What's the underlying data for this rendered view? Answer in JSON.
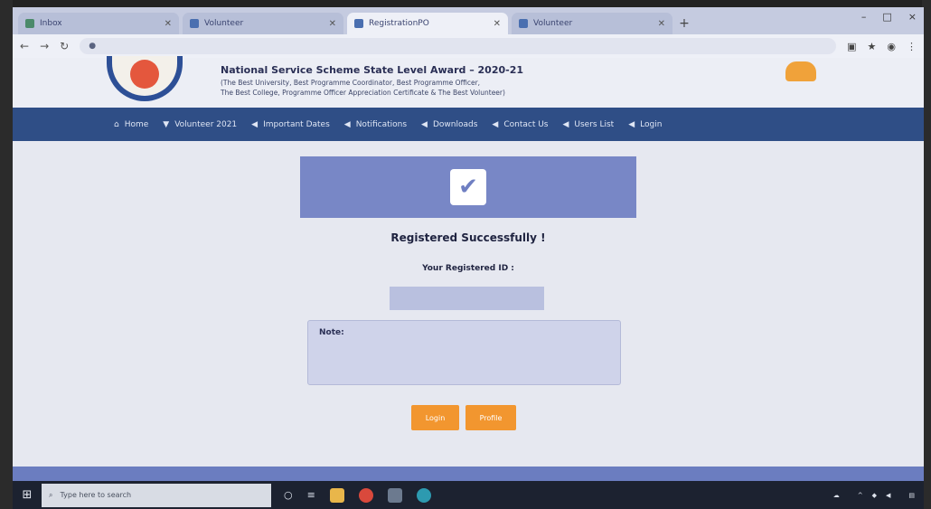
{
  "browser": {
    "tabs": [
      {
        "label": "Inbox",
        "active": false,
        "icon": "mail-favicon"
      },
      {
        "label": "Volunteer",
        "active": false,
        "icon": "doc-favicon"
      },
      {
        "label": "RegistrationPO",
        "active": true,
        "icon": "site-favicon"
      },
      {
        "label": "Volunteer",
        "active": false,
        "icon": "doc-favicon"
      }
    ],
    "new_tab": "+",
    "url": "",
    "window_controls": [
      "–",
      "□",
      "×"
    ]
  },
  "site": {
    "title": "National Service Scheme State Level Award – 2020-21",
    "subtitle_1": "(The Best University, Best Programme Coordinator, Best Programme Officer,",
    "subtitle_2": "The Best College, Programme Officer Appreciation Certificate & The Best Volunteer)"
  },
  "nav": [
    {
      "label": "Home",
      "icon": "home-icon"
    },
    {
      "label": "Volunteer 2021",
      "icon": "trophy-icon"
    },
    {
      "label": "Important Dates",
      "icon": "calendar-icon"
    },
    {
      "label": "Notifications",
      "icon": "megaphone-icon"
    },
    {
      "label": "Downloads",
      "icon": "download-icon"
    },
    {
      "label": "Contact Us",
      "icon": "phone-icon"
    },
    {
      "label": "Users List",
      "icon": "list-icon"
    },
    {
      "label": "Login",
      "icon": "login-icon"
    }
  ],
  "main": {
    "success_title": "Registered Successfully !",
    "reg_id_label": "Your Registered ID :",
    "reg_id_value": "",
    "note_title": "Note:",
    "note_body": "",
    "login_button": "Login",
    "profile_button": "Profile"
  },
  "taskbar": {
    "search_placeholder": "Type here to search",
    "weather": "",
    "time": "",
    "date": ""
  },
  "colors": {
    "nav_bg": "#2f4e86",
    "banner": "#7887c6",
    "button": "#f2962f"
  }
}
